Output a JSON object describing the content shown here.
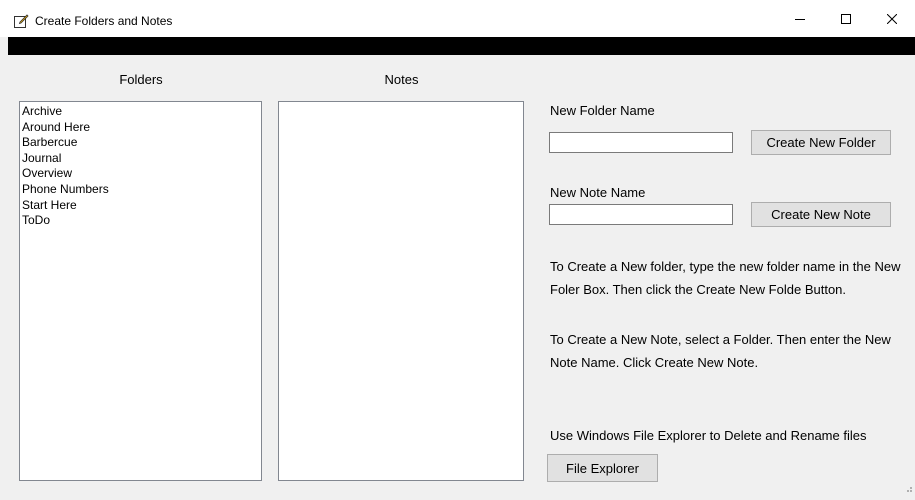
{
  "window": {
    "title": "Create Folders and Notes",
    "controls": [
      "minimize",
      "maximize",
      "close"
    ]
  },
  "folders_panel": {
    "label": "Folders",
    "items": [
      "Archive",
      "Around Here",
      "Barbercue",
      "Journal",
      "Overview",
      "Phone Numbers",
      "Start Here",
      "ToDo"
    ]
  },
  "notes_panel": {
    "label": "Notes",
    "items": []
  },
  "new_folder": {
    "label": "New Folder Name",
    "value": "",
    "button_label": "Create New Folder"
  },
  "new_note": {
    "label": "New Note Name",
    "value": "",
    "button_label": "Create New Note"
  },
  "instructions": {
    "folder_text": "To Create a New folder, type  the new folder name in the New Foler Box. Then click the Create New Folde Button.",
    "note_text": "To Create a New Note, select a Folder. Then enter the New Note Name. Click Create New Note.",
    "explorer_text": "Use Windows File Explorer to Delete and Rename files"
  },
  "file_explorer": {
    "button_label": "File Explorer"
  }
}
